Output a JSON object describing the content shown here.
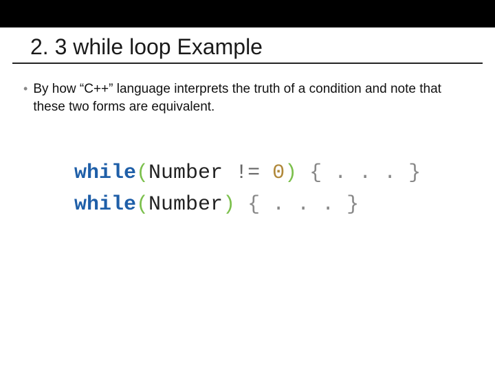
{
  "slide": {
    "title": "2. 3 while loop  Example",
    "bullet": "By how “C++” language interprets the truth of a condition and note that these two forms are equivalent."
  },
  "code": {
    "kw": "while",
    "paren_open": "(",
    "paren_close": ")",
    "ident": "Number",
    "op_ne": " != ",
    "zero": "0",
    "body": " { . . . }"
  }
}
